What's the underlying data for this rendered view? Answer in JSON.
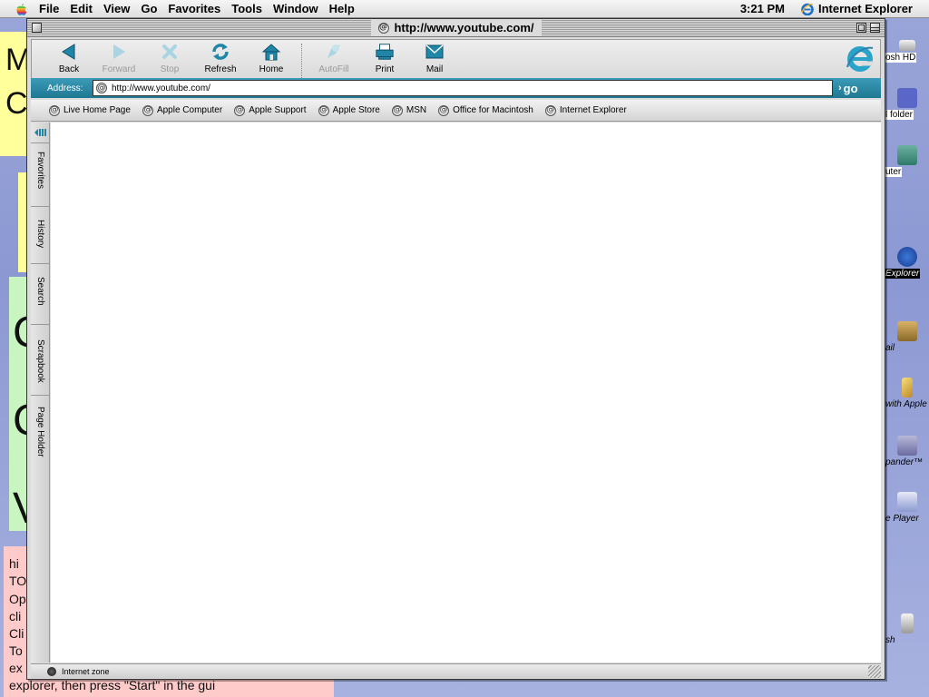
{
  "menubar": {
    "apple_icon": "apple-logo-icon",
    "items": [
      "File",
      "Edit",
      "View",
      "Go",
      "Favorites",
      "Tools",
      "Window",
      "Help"
    ],
    "clock": "3:21 PM",
    "active_app": "Internet Explorer"
  },
  "desktop": {
    "stickies": {
      "yellow_letters": [
        "M",
        "C"
      ],
      "green_letters": [
        "C",
        "C",
        "V"
      ],
      "pink_lines": [
        "hi",
        "TO",
        "Op",
        "cli",
        "Cli",
        "To",
        "ex",
        "explorer, then press \"Start\" in the gui"
      ]
    },
    "icons": [
      {
        "label": "osh HD",
        "icon": "hard-drive-icon"
      },
      {
        "label": "l folder",
        "icon": "folder-icon"
      },
      {
        "label": "uter",
        "icon": "computer-icon"
      },
      {
        "label": "Explorer",
        "icon": "internet-explorer-icon"
      },
      {
        "label": "ail",
        "icon": "mail-icon"
      },
      {
        "label": "with Apple",
        "icon": "pencil-icon"
      },
      {
        "label": "pander™",
        "icon": "stuffit-expander-icon"
      },
      {
        "label": "e Player",
        "icon": "quicktime-player-icon"
      },
      {
        "label": "sh",
        "icon": "trash-icon"
      }
    ]
  },
  "window": {
    "title": "http://www.youtube.com/",
    "toolbar": [
      {
        "label": "Back",
        "icon": "back-arrow-icon",
        "enabled": true
      },
      {
        "label": "Forward",
        "icon": "forward-arrow-icon",
        "enabled": false
      },
      {
        "label": "Stop",
        "icon": "stop-x-icon",
        "enabled": false
      },
      {
        "label": "Refresh",
        "icon": "refresh-icon",
        "enabled": true
      },
      {
        "label": "Home",
        "icon": "home-icon",
        "enabled": true
      },
      {
        "label": "AutoFill",
        "icon": "autofill-icon",
        "enabled": false
      },
      {
        "label": "Print",
        "icon": "print-icon",
        "enabled": true
      },
      {
        "label": "Mail",
        "icon": "mail-icon",
        "enabled": true
      }
    ],
    "address": {
      "label": "Address:",
      "value": "http://www.youtube.com/",
      "go_label": "go"
    },
    "favorites": [
      "Live Home Page",
      "Apple Computer",
      "Apple Support",
      "Apple Store",
      "MSN",
      "Office for Macintosh",
      "Internet Explorer"
    ],
    "explorer_tabs": [
      "Favorites",
      "History",
      "Search",
      "Scrapbook",
      "Page Holder"
    ],
    "status": "Internet zone"
  },
  "colors": {
    "address_bar": "#2a89a5",
    "toolbar_icons": "#1f86a8",
    "desktop": "#9aa6d8",
    "page_background": "#ffffff"
  }
}
